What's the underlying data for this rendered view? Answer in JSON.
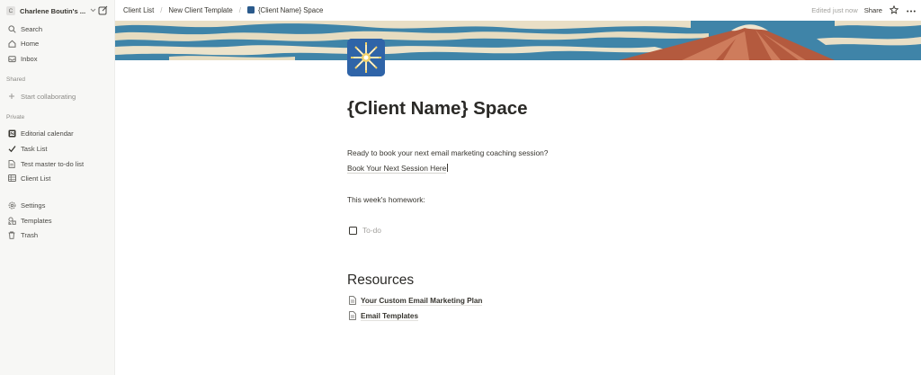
{
  "workspace": {
    "badge": "C",
    "name": "Charlene Boutin's ..."
  },
  "sidebar": {
    "top_items": [
      {
        "label": "Search",
        "icon": "search-icon"
      },
      {
        "label": "Home",
        "icon": "home-icon"
      },
      {
        "label": "Inbox",
        "icon": "inbox-icon"
      }
    ],
    "shared_heading": "Shared",
    "shared_items": [
      {
        "label": "Start collaborating",
        "icon": "plus-icon"
      }
    ],
    "private_heading": "Private",
    "private_items": [
      {
        "label": "Editorial calendar",
        "icon": "notion-calendar-icon"
      },
      {
        "label": "Task List",
        "icon": "checkmark-icon"
      },
      {
        "label": "Test master to-do list",
        "icon": "page-icon"
      },
      {
        "label": "Client List",
        "icon": "table-icon"
      }
    ],
    "bottom_items": [
      {
        "label": "Settings",
        "icon": "gear-icon"
      },
      {
        "label": "Templates",
        "icon": "templates-icon"
      },
      {
        "label": "Trash",
        "icon": "trash-icon"
      }
    ]
  },
  "topbar": {
    "breadcrumbs": [
      "Client List",
      "New Client Template",
      "{Client Name} Space"
    ],
    "edited": "Edited just now",
    "share": "Share"
  },
  "page": {
    "title": "{Client Name} Space",
    "intro": "Ready to book your next email marketing coaching session?",
    "book_link": "Book Your Next Session Here",
    "homework_label": "This week's homework:",
    "todo_placeholder": "To-do",
    "resources_heading": "Resources",
    "resources": [
      "Your Custom Email Marketing Plan",
      "Email Templates"
    ]
  },
  "colors": {
    "sidebar_bg": "#f7f7f5",
    "text": "#37352f",
    "icon_bg": "#2f64a8"
  }
}
